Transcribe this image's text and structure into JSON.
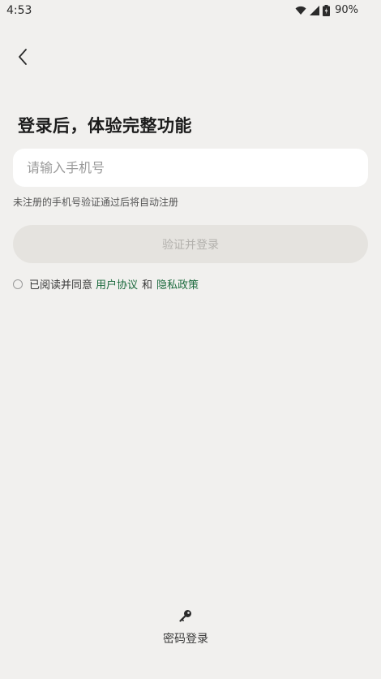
{
  "status_bar": {
    "time": "4:53",
    "battery": "90%"
  },
  "login": {
    "title": "登录后，体验完整功能",
    "phone_placeholder": "请输入手机号",
    "hint": "未注册的手机号验证通过后将自动注册",
    "submit_label": "验证并登录",
    "agreement": {
      "prefix": "已阅读并同意",
      "user_agreement": "用户协议",
      "conjunction": "和",
      "privacy_policy": "隐私政策"
    },
    "password_login_label": "密码登录"
  },
  "colors": {
    "background": "#f1f0ee",
    "link": "#1b6a3d",
    "button_disabled_bg": "#e5e3df"
  },
  "icons": {
    "back": "back-arrow-icon",
    "password": "key-icon",
    "wifi": "wifi-icon",
    "signal": "signal-icon",
    "battery": "battery-icon"
  }
}
